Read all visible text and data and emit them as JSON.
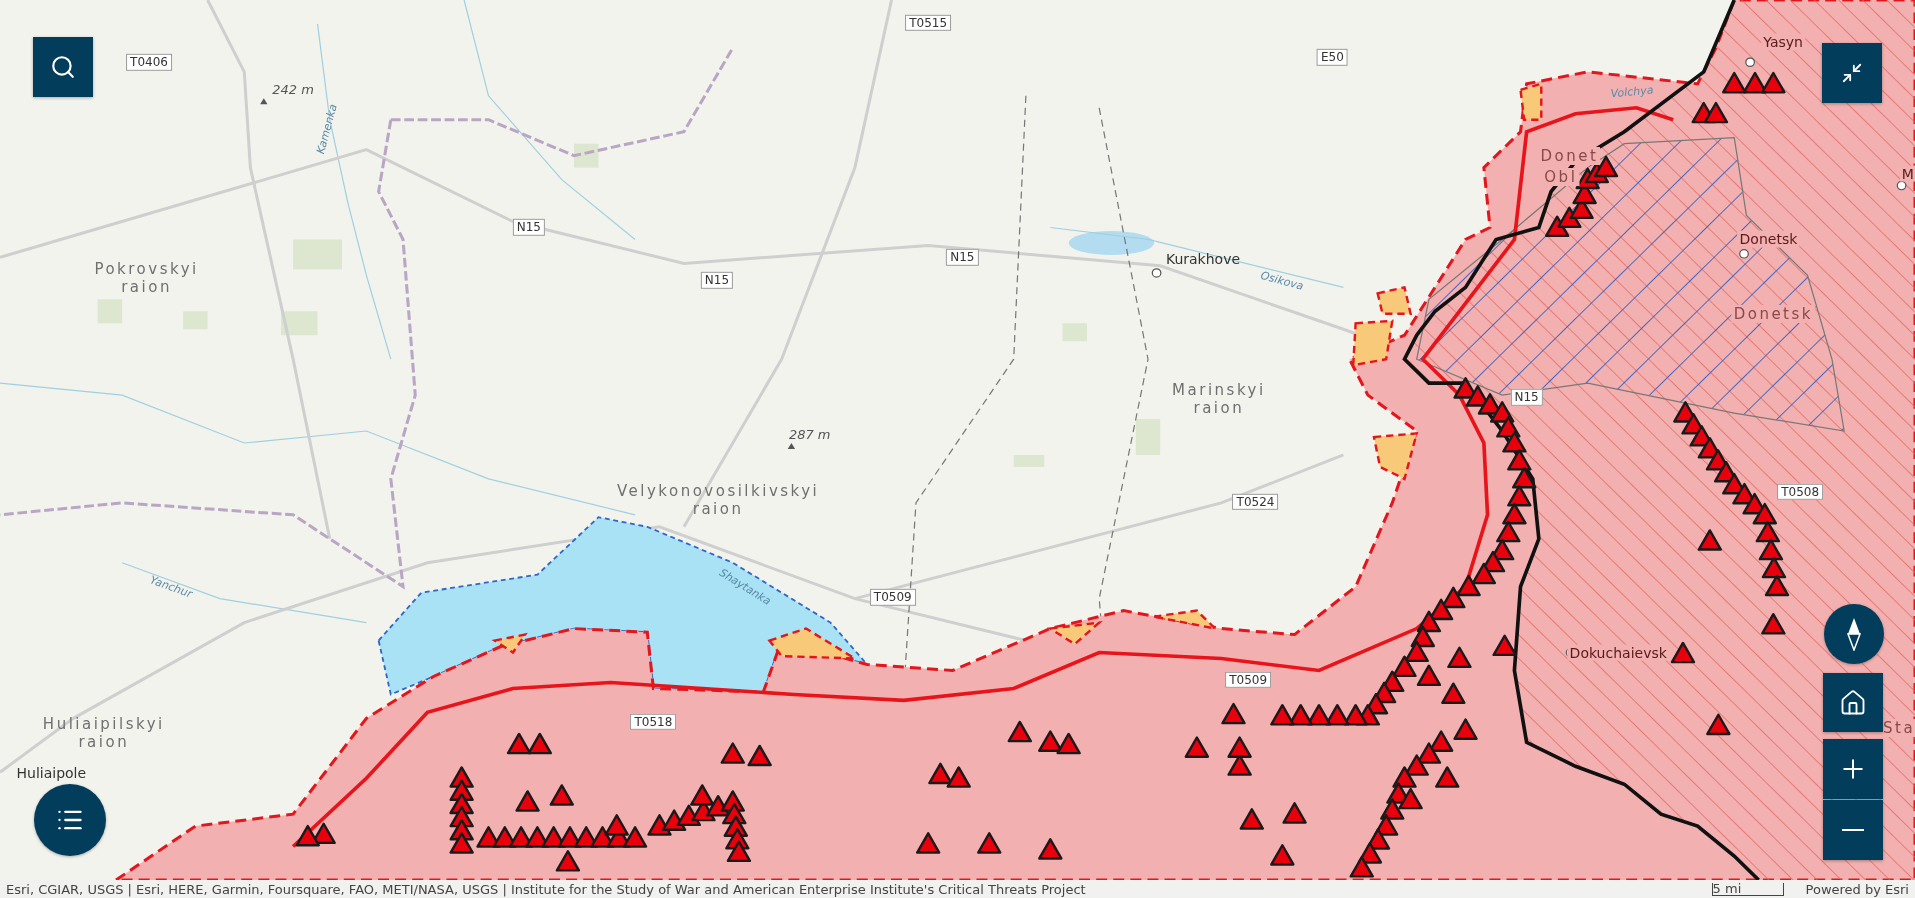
{
  "map_labels": [
    {
      "kind": "road",
      "text": "T0406"
    },
    {
      "kind": "road",
      "text": "T0515"
    },
    {
      "kind": "road",
      "text": "E50"
    },
    {
      "kind": "road",
      "text": "N15"
    },
    {
      "kind": "road",
      "text": "N15"
    },
    {
      "kind": "road",
      "text": "N15"
    },
    {
      "kind": "road",
      "text": "N15"
    },
    {
      "kind": "road",
      "text": "T0524"
    },
    {
      "kind": "road",
      "text": "T0508"
    },
    {
      "kind": "road",
      "text": "T0509"
    },
    {
      "kind": "road",
      "text": "T0509"
    },
    {
      "kind": "road",
      "text": "T0518"
    },
    {
      "kind": "elevation",
      "text": "242 m"
    },
    {
      "kind": "elevation",
      "text": "287 m"
    },
    {
      "kind": "river",
      "text": "Kamenka"
    },
    {
      "kind": "river",
      "text": "Volchya"
    },
    {
      "kind": "river",
      "text": "Osikova"
    },
    {
      "kind": "river",
      "text": "Yanchur"
    },
    {
      "kind": "river",
      "text": "Shaytanka"
    },
    {
      "kind": "place",
      "text": "Kurakhove"
    },
    {
      "kind": "place",
      "text": "Donetsk"
    },
    {
      "kind": "place",
      "text": "Dokuchaievsk"
    },
    {
      "kind": "place",
      "text": "Yasyn"
    },
    {
      "kind": "place",
      "text": "M"
    },
    {
      "kind": "region",
      "text": "Sta"
    },
    {
      "kind": "region",
      "text": "Pokrovskyi raion"
    },
    {
      "kind": "region",
      "text": "Marinskyi raion"
    },
    {
      "kind": "region",
      "text": "Velykonovosilkivskyi raion"
    },
    {
      "kind": "region",
      "text": "Huliaipilskyi raion"
    },
    {
      "kind": "region",
      "text": "Donetsk"
    },
    {
      "kind": "region",
      "text": "Donet"
    },
    {
      "kind": "region",
      "text": "Obl"
    },
    {
      "kind": "place",
      "text": "Huliaipole"
    }
  ],
  "attribution": {
    "text": "Esri, CGIAR, USGS | Esri, HERE, Garmin, Foursquare, FAO, METI/NASA, USGS | Institute for the Study of War and American Enterprise Institute's Critical Threats Project",
    "scale": "5 mi",
    "powered_by": "Powered by Esri"
  }
}
